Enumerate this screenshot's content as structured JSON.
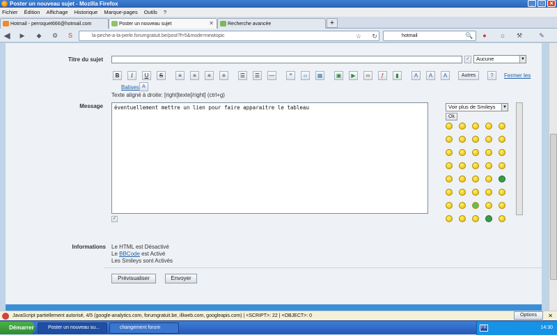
{
  "window": {
    "title": "Poster un nouveau sujet - Mozilla Firefox"
  },
  "menu": [
    "Fichier",
    "Édition",
    "Affichage",
    "Historique",
    "Marque-pages",
    "Outils",
    "?"
  ],
  "tabs": [
    {
      "label": "Hotmail - perroquet666@hotmail.com"
    },
    {
      "label": "Poster un nouveau sujet"
    },
    {
      "label": "Recherche avancée"
    }
  ],
  "address": {
    "domain": "la-peche-a-la-perle.forumgratuit.be",
    "path": "/post?f=5&mode=newtopic",
    "search_engine": "hotmail"
  },
  "form": {
    "subject_label": "Titre du sujet",
    "subject_value": "",
    "topic_type": "Aucune",
    "toolbar": {
      "close_tags": "Fermer les",
      "tags": "Balises",
      "autres": "Autres"
    },
    "hint": "Texte aligné à droite: [right]texte[/right] (ctrl+g)",
    "message_label": "Message",
    "message_value": "éventuellement mettre un lien pour faire apparaitre le tableau",
    "smileys_select": "Voir plus de Smileys",
    "ok": "Ok",
    "info_label": "Informations",
    "info": {
      "html": "Le HTML est Désactivé",
      "bb_pre": "Le ",
      "bbcode": "BBCode",
      "bb_post": " est Activé",
      "smileys": "Les Smileys sont Activés"
    },
    "preview": "Prévisualiser",
    "send": "Envoyer"
  },
  "statusbar": {
    "text": "JavaScript partiellement autorisé, 4/5 (google-analytics.com, forumgratuit.be, illiweb.com, googleapis.com) | <SCRIPT>: 22 | <OBJECT>: 0",
    "options": "Options"
  },
  "taskbar": {
    "start": "Démarrer",
    "tasks": [
      "Poster un nouveau su...",
      "changement forum"
    ],
    "lang": "FR",
    "time": "14:30"
  }
}
